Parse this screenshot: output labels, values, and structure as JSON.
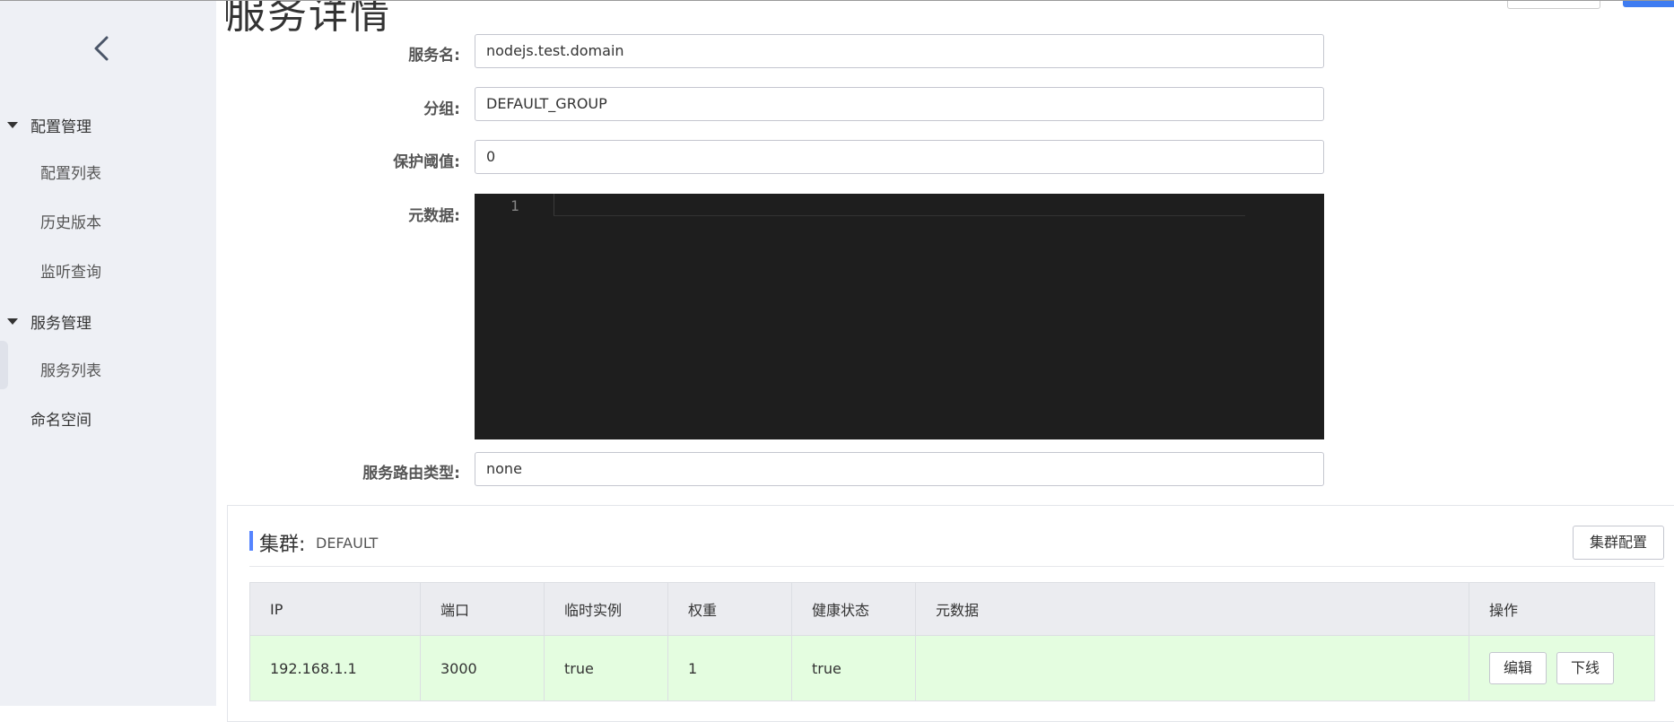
{
  "sidebar": {
    "groups": [
      {
        "label": "配置管理",
        "items": [
          "配置列表",
          "历史版本",
          "监听查询"
        ]
      },
      {
        "label": "服务管理",
        "items": [
          "服务列表"
        ]
      }
    ],
    "standalone": "命名空间",
    "active_item": "服务列表"
  },
  "page": {
    "title": "服务详情"
  },
  "form": {
    "service_name_label": "服务名:",
    "service_name_value": "nodejs.test.domain",
    "group_label": "分组:",
    "group_value": "DEFAULT_GROUP",
    "threshold_label": "保护阈值:",
    "threshold_value": "0",
    "metadata_label": "元数据:",
    "metadata_line_number": "1",
    "selector_label": "服务路由类型:",
    "selector_value": "none"
  },
  "cluster": {
    "title": "集群:",
    "name": "DEFAULT",
    "config_button": "集群配置",
    "columns": [
      "IP",
      "端口",
      "临时实例",
      "权重",
      "健康状态",
      "元数据",
      "操作"
    ],
    "rows": [
      {
        "ip": "192.168.1.1",
        "port": "3000",
        "ephemeral": "true",
        "weight": "1",
        "healthy": "true",
        "metadata": ""
      }
    ],
    "edit_button": "编辑",
    "offline_button": "下线"
  },
  "colors": {
    "accent": "#5584ff",
    "row_bg": "#e4fde0",
    "editor_bg": "#1e1e1e",
    "sidebar_bg": "#eef0f5"
  }
}
